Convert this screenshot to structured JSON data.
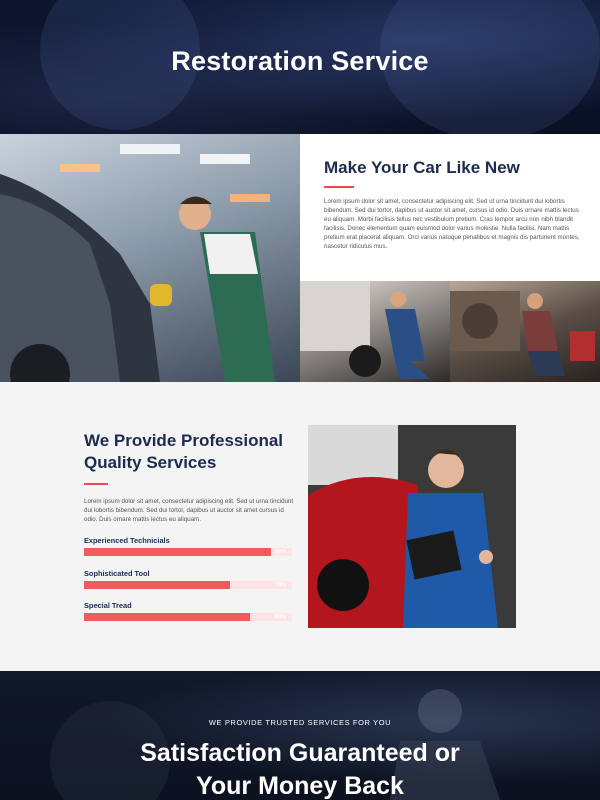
{
  "hero": {
    "title": "Restoration Service"
  },
  "feature": {
    "title": "Make Your Car Like New",
    "body": "Lorem ipsum dolor sit amet, consectetur adipiscing elit. Sed ut urna tincidunt dui lobortis bibendum. Sed dui tortor, dapibus ut auctor sit amet, cursus id odio. Duis ornare mattis lectus eu aliquam. Morbi facilisis tellus nec vestibulum pretium. Cras tempor arcu non nibh blandit facilisis. Donec elementum quam euismod dolor varius molestie. Nulla facilisi. Nam mattis pretium erat placerat aliquam. Orci varius natoque penatibus et magnis dis parturient montes, nascetur ridiculus mus."
  },
  "services": {
    "title": "We Provide Professional Quality Services",
    "body": "Lorem ipsum dolor sit amet, consectetur adipiscing elit. Sed ut urna tincidunt dui lobortis bibendum. Sed dui tortor, dapibus ut auctor sit amet cursus id odio. Duis ornare mattis lectus eu aliquam.",
    "skills": [
      {
        "label": "Experienced Technicials",
        "percent": 90,
        "percent_text": "90%"
      },
      {
        "label": "Sophisticated Tool",
        "percent": 70,
        "percent_text": "70%"
      },
      {
        "label": "Special Tread",
        "percent": 80,
        "percent_text": "80%"
      }
    ]
  },
  "guarantee": {
    "eyebrow": "WE PROVIDE TRUSTED SERVICES FOR YOU",
    "title_line1": "Satisfaction Guaranteed or",
    "title_line2": "Your Money Back"
  },
  "colors": {
    "accent": "#ef5a5a",
    "navy": "#1c2b4f",
    "track": "#fde3e3"
  }
}
